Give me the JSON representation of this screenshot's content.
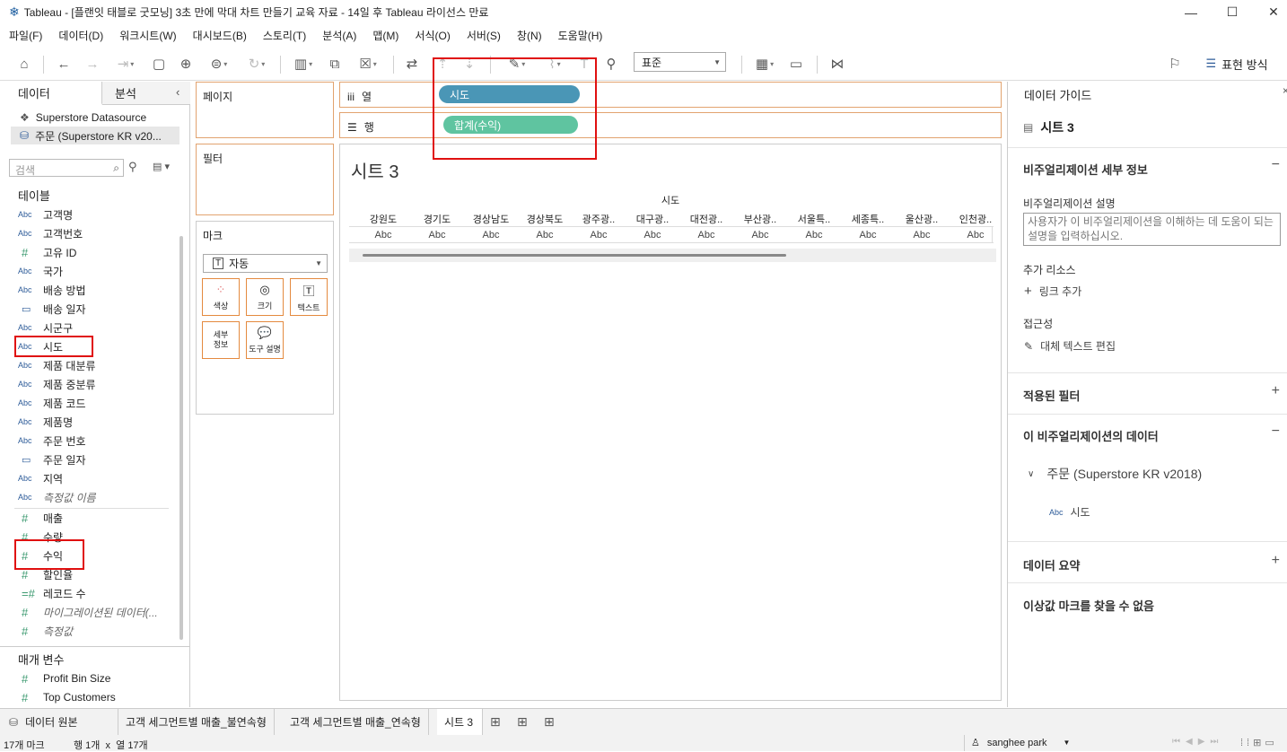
{
  "window": {
    "title": "Tableau - [플랜잇 태블로 굿모닝] 3초 만에 막대 차트 만들기 교육 자료 - 14일 후 Tableau 라이선스 만료",
    "minimize": "—",
    "maximize": "☐",
    "close": "✕"
  },
  "menu": [
    "파일(F)",
    "데이터(D)",
    "워크시트(W)",
    "대시보드(B)",
    "스토리(T)",
    "분석(A)",
    "맵(M)",
    "서식(O)",
    "서버(S)",
    "창(N)",
    "도움말(H)"
  ],
  "toolbar": {
    "fit_select": "표준",
    "show_me_label": "표현 방식"
  },
  "left_pane": {
    "tab_data": "데이터",
    "tab_analytics": "분석",
    "datasources": [
      "Superstore Datasource",
      "주문 (Superstore KR v20..."
    ],
    "search_placeholder": "검색",
    "tables_label": "테이블",
    "fields": [
      {
        "type": "Abc",
        "name": "고객명"
      },
      {
        "type": "Abc",
        "name": "고객번호"
      },
      {
        "type": "#",
        "name": "고유 ID"
      },
      {
        "type": "Abc",
        "name": "국가"
      },
      {
        "type": "Abc",
        "name": "배송 방법"
      },
      {
        "type": "date",
        "name": "배송 일자"
      },
      {
        "type": "Abc",
        "name": "시군구"
      },
      {
        "type": "Abc",
        "name": "시도"
      },
      {
        "type": "Abc",
        "name": "제품 대분류"
      },
      {
        "type": "Abc",
        "name": "제품 중분류"
      },
      {
        "type": "Abc",
        "name": "제품 코드"
      },
      {
        "type": "Abc",
        "name": "제품명"
      },
      {
        "type": "Abc",
        "name": "주문 번호"
      },
      {
        "type": "date",
        "name": "주문 일자"
      },
      {
        "type": "Abc",
        "name": "지역"
      },
      {
        "type": "Abc",
        "name": "측정값 이름",
        "italic": true
      }
    ],
    "measures": [
      {
        "type": "#",
        "name": "매출"
      },
      {
        "type": "#",
        "name": "수량"
      },
      {
        "type": "#",
        "name": "수익"
      },
      {
        "type": "#",
        "name": "할인율"
      },
      {
        "type": "=#",
        "name": "레코드 수"
      },
      {
        "type": "#",
        "name": "마이그레이션된 데이터(...",
        "italic": true
      },
      {
        "type": "#",
        "name": "측정값",
        "italic": true
      }
    ],
    "params_label": "매개 변수",
    "params": [
      {
        "type": "#",
        "name": "Profit Bin Size"
      },
      {
        "type": "#",
        "name": "Top Customers"
      }
    ]
  },
  "cards": {
    "pages": "페이지",
    "filters": "필터",
    "marks": "마크",
    "mark_type": "자동",
    "mark_buttons": [
      {
        "icon": "color-icon",
        "label": "색상"
      },
      {
        "icon": "size-icon",
        "label": "크기"
      },
      {
        "icon": "text-icon",
        "label": "텍스트"
      },
      {
        "icon": "detail-icon",
        "label": "세부\n정보"
      },
      {
        "icon": "tooltip-icon",
        "label": "도구 설명"
      }
    ]
  },
  "shelves": {
    "columns_label": "열",
    "rows_label": "행",
    "columns_pill": "시도",
    "rows_pill": "합계(수익)"
  },
  "view": {
    "sheet_title": "시트 3",
    "header_title": "시도",
    "columns": [
      "강원도",
      "경기도",
      "경상남도",
      "경상북도",
      "광주광..",
      "대구광..",
      "대전광..",
      "부산광..",
      "서울특..",
      "세종특..",
      "울산광..",
      "인천광.."
    ],
    "cell_text": "Abc"
  },
  "right_pane": {
    "title": "데이터 가이드",
    "sheet_name": "시트 3",
    "viz_details": "비주얼리제이션 세부 정보",
    "viz_desc_label": "비주얼리제이션 설명",
    "viz_desc_placeholder": "사용자가 이 비주얼리제이션을 이해하는 데 도움이 되는 설명을 입력하십시오.",
    "extra_resources": "추가 리소스",
    "add_link": "링크 추가",
    "accessibility": "접근성",
    "edit_alt_text": "대체 텍스트 편집",
    "applied_filters": "적용된 필터",
    "viz_data": "이 비주얼리제이션의 데이터",
    "datasource_item": "주문 (Superstore KR v2018)",
    "field_item": "시도",
    "field_item_type": "Abc",
    "data_summary": "데이터 요약",
    "no_outliers": "이상값 마크를 찾을 수 없음"
  },
  "bottom_tabs": {
    "datasource": "데이터 원본",
    "tabs": [
      "고객 세그먼트별 매출_불연속형",
      "고객 세그먼트별 매출_연속형",
      "시트 3"
    ]
  },
  "status": {
    "marks": "17개 마크",
    "rows_cols": "행 1개  x  열 17개",
    "user": "sanghee park"
  },
  "colors": {
    "dimension_pill": "#4a96b6",
    "measure_pill": "#5fc4a0",
    "shelf_border": "#e2a36f",
    "highlight": "#e01010"
  }
}
